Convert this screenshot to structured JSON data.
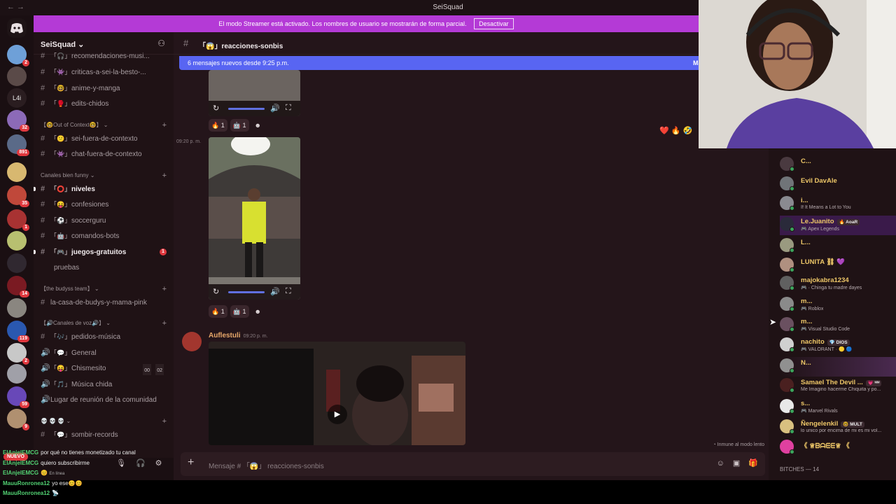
{
  "window": {
    "title": "SeiSquad",
    "nav": "←  →"
  },
  "banner": {
    "text": "El modo Streamer está activado. Los nombres de usuario se mostrarán de forma parcial.",
    "button": "Desactivar"
  },
  "servers": {
    "badges": [
      "2",
      "32",
      "891",
      "35",
      "1",
      "14",
      "119",
      "2",
      "59",
      "9"
    ],
    "l4i": "L4i",
    "nuevo": "NUEVO"
  },
  "server": {
    "name": "SeiSquad ⌄",
    "invite_icon": "person-add-icon"
  },
  "channels": {
    "top": [
      {
        "emo": "「🎧」",
        "name": "recomendaciones-musi..."
      },
      {
        "emo": "「👾」",
        "name": "criticas-a-sei-la-besto-..."
      },
      {
        "emo": "「🤓」",
        "name": "anime-y-manga"
      },
      {
        "emo": "「🥊」",
        "name": "edits-chidos"
      }
    ],
    "cat1": "【🤓Out of Context🤓】 ⌄",
    "cat1_items": [
      {
        "emo": "「😕」",
        "name": "sei-fuera-de-contexto"
      },
      {
        "emo": "「👾」",
        "name": "chat-fuera-de-contexto"
      }
    ],
    "cat2": "Canales bien funny ⌄",
    "cat2_items": [
      {
        "emo": "「⭕」",
        "name": "niveles"
      },
      {
        "emo": "「😝」",
        "name": "confesiones"
      },
      {
        "emo": "「⚽」",
        "name": "soccerguru"
      },
      {
        "emo": "「🤖」",
        "name": "comandos-bots"
      },
      {
        "emo": "「🎮」",
        "name": "juegos-gratuitos",
        "badge": "1"
      }
    ],
    "pruebas": "pruebas",
    "cat3": "【the budyss team】 ⌄",
    "cat3_items": [
      {
        "name": "la-casa-de-budys-y-mama-pink"
      }
    ],
    "cat4": "【🔊Canales de voz🔊】 ⌄",
    "cat4_items": [
      {
        "emo": "「🎶」",
        "name": "pedidos-música"
      },
      {
        "emo": "「💬」",
        "name": "General"
      },
      {
        "emo": "「😝」",
        "name": "Chismesito",
        "count1": "00",
        "count2": "02"
      },
      {
        "emo": "「🎵」",
        "name": "Música chida"
      },
      {
        "name": "Lugar de reunión de la comunidad"
      }
    ],
    "cat5": "💀 💀 💀 ⌄",
    "cat5_items": [
      {
        "emo": "「💬」",
        "name": "sombir-records"
      }
    ]
  },
  "chatlog": [
    {
      "user": "ElAnjelEMCG",
      "text": "por qué no tienes monetizado tu canal"
    },
    {
      "user": "ElAnjelEMCG",
      "text": "quiero subscribirme"
    },
    {
      "user": "ElAnjelEMCG",
      "text": "😊",
      "sub": "En línea"
    },
    {
      "user": "MauuRonronea12",
      "text": "yo ese😊😊"
    },
    {
      "user": "MauuRonronea12",
      "text": "📡"
    }
  ],
  "chat": {
    "channel_name": "「😱」reacciones-sonbis",
    "new_messages": "6 mensajes nuevos desde 9:25 p.m.",
    "new_messages_mark": "Mar",
    "reactions": [
      {
        "emoji": "🔥",
        "count": "1"
      },
      {
        "emoji": "🤖",
        "count": "1"
      }
    ],
    "timestamp_1": "09:20 p. m.",
    "author": "Auflestuli",
    "author_time": "09:20 p. m.",
    "slowmode": "Inmune al modo lento",
    "placeholder": "Mensaje # 「😱」 reacciones-sonbis",
    "float_reacts": "❤️ 🔥 🤣"
  },
  "members": [
    {
      "name": "C...",
      "sub": ""
    },
    {
      "name": "Evil DavAle",
      "sub": ""
    },
    {
      "name": "i...",
      "sub": "If It Means a Lot to You"
    },
    {
      "name": "Le.Juanito",
      "sub": "🎮 Apex Legends",
      "tag": "🔥 AoaR"
    },
    {
      "name": "L...",
      "sub": ""
    },
    {
      "name": "LUNITA ⛓ 💜",
      "sub": ""
    },
    {
      "name": "majokabra1234",
      "sub": "🎮 · Chinga tu madre dayes"
    },
    {
      "name": "m...",
      "sub": "🎮 Roblox"
    },
    {
      "name": "m...",
      "sub": "🎮 Visual Studio Code"
    },
    {
      "name": "nachito",
      "sub": "🎮 VALORANT · 🟡 🔵",
      "tag": "💎 DIOS"
    },
    {
      "name": "N...",
      "sub": ""
    },
    {
      "name": "Samael The Devil ...",
      "sub": "Me Imagino hacerme Chiquita y po...",
      "tag": "💗 ᴹᴹ"
    },
    {
      "name": "s...",
      "sub": "🎮 Marvel Rivals"
    },
    {
      "name": "Ñengelenkil",
      "sub": "lo unico por encima de mi es mi vol...",
      "tag": "🤓 MULT"
    },
    {
      "name": "《 ♕ᗷᗩᗴᗴ♕ 《",
      "sub": ""
    }
  ],
  "members_cat": "BITCHES — 14",
  "colors": {
    "accent": "#5865f2",
    "banner": "#b43ad6",
    "username": "#eec768"
  }
}
